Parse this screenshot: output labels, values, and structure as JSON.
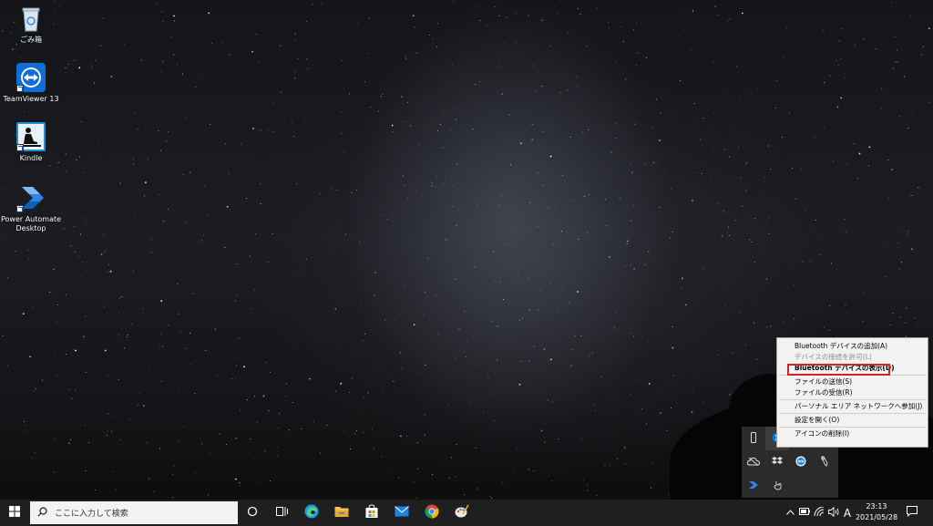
{
  "desktop": {
    "icons": [
      {
        "label": "ごみ箱"
      },
      {
        "label": "TeamViewer 13"
      },
      {
        "label": "Kindle"
      },
      {
        "label": "Power Automate Desktop"
      }
    ]
  },
  "context_menu": {
    "items": [
      {
        "label": "Bluetooth デバイスの追加(A)"
      },
      {
        "label": "デバイスの接続を許可(L)"
      },
      {
        "label": "Bluetooth デバイスの表示(D)"
      },
      {
        "label": "ファイルの送信(S)"
      },
      {
        "label": "ファイルの受信(R)"
      },
      {
        "label": "パーソナル エリア ネットワークへ参加(J)"
      },
      {
        "label": "設定を開く(O)"
      },
      {
        "label": "アイコンの削除(I)"
      }
    ]
  },
  "taskbar": {
    "search_placeholder": "ここに入力して検索",
    "ime_label": "A",
    "clock_time": "23:13",
    "clock_date": "2021/05/28"
  },
  "colors": {
    "taskbar_bg": "#1f1f1f",
    "menu_bg": "#f2f2f2",
    "highlight_red": "#d2232a",
    "accent_blue": "#0078d4"
  }
}
